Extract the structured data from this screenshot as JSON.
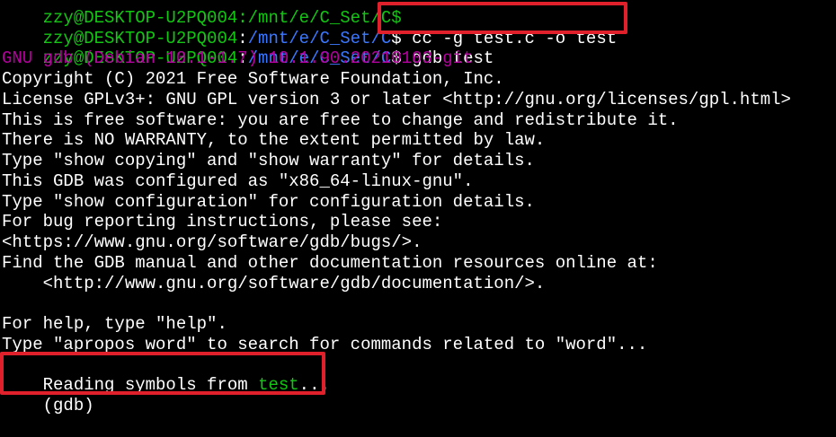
{
  "colors": {
    "background": "#000000",
    "user_host": "#13c613",
    "path": "#3b78ff",
    "gdb_version": "#b4009e",
    "text": "#ffffff",
    "filename": "#13c613",
    "highlight": "#e0202a"
  },
  "line0": {
    "text": "zzy@DESKTOP-U2PQ004:/mnt/e/C_Set/C$"
  },
  "prompt1": {
    "user_host": "zzy@DESKTOP-U2PQ004",
    "sep": ":",
    "path": "/mnt/e/C_Set/C",
    "sign": "$",
    "command": " cc -g test.c -o test"
  },
  "prompt2": {
    "user_host": "zzy@DESKTOP-U2PQ004",
    "sep": ":",
    "path": "/mnt/e/C_Set/C",
    "sign": "$",
    "command": " gdb test"
  },
  "gdb_version": "GNU gdb (Debian 10.1-1.7) 10.1.90.20210103-git",
  "banner": [
    "Copyright (C) 2021 Free Software Foundation, Inc.",
    "License GPLv3+: GNU GPL version 3 or later <http://gnu.org/licenses/gpl.html>",
    "This is free software: you are free to change and redistribute it.",
    "There is NO WARRANTY, to the extent permitted by law.",
    "Type \"show copying\" and \"show warranty\" for details.",
    "This GDB was configured as \"x86_64-linux-gnu\".",
    "Type \"show configuration\" for configuration details.",
    "For bug reporting instructions, please see:",
    "<https://www.gnu.org/software/gdb/bugs/>.",
    "Find the GDB manual and other documentation resources online at:",
    "    <http://www.gnu.org/software/gdb/documentation/>.",
    "",
    "For help, type \"help\".",
    "Type \"apropos word\" to search for commands related to \"word\"..."
  ],
  "reading": {
    "prefix": "Reading symbols from ",
    "file": "test",
    "suffix": "..."
  },
  "gdb_prompt": "(gdb)"
}
